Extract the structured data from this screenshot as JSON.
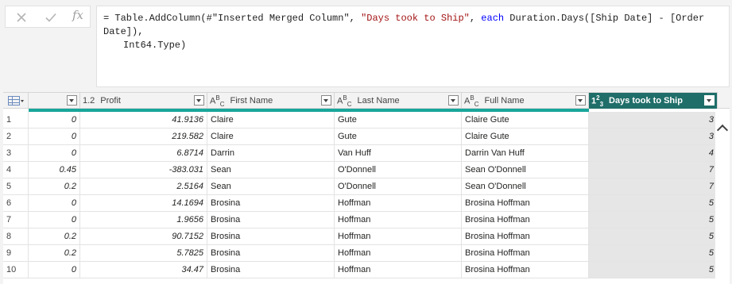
{
  "formula": {
    "prefix": "= Table.AddColumn(#\"Inserted Merged Column\", ",
    "col_name": "\"Days took to Ship\"",
    "mid": ", ",
    "each_kw": "each",
    "expr": " Duration.Days([Ship Date] - [Order Date]),",
    "line2": "Int64.Type)"
  },
  "columns": [
    {
      "type_label": "",
      "name": ""
    },
    {
      "type_label": "1.2",
      "name": "Profit"
    },
    {
      "type_label": "ABC",
      "name": "First Name"
    },
    {
      "type_label": "ABC",
      "name": "Last Name"
    },
    {
      "type_label": "ABC",
      "name": "Full Name"
    },
    {
      "type_label": "123",
      "name": "Days took to Ship"
    }
  ],
  "rows": [
    {
      "idx": "1",
      "c0": "0",
      "profit": "41.9136",
      "first": "Claire",
      "last": "Gute",
      "full": "Claire Gute",
      "days": "3"
    },
    {
      "idx": "2",
      "c0": "0",
      "profit": "219.582",
      "first": "Claire",
      "last": "Gute",
      "full": "Claire Gute",
      "days": "3"
    },
    {
      "idx": "3",
      "c0": "0",
      "profit": "6.8714",
      "first": "Darrin",
      "last": "Van Huff",
      "full": "Darrin Van Huff",
      "days": "4"
    },
    {
      "idx": "4",
      "c0": "0.45",
      "profit": "-383.031",
      "first": "Sean",
      "last": "O'Donnell",
      "full": "Sean O'Donnell",
      "days": "7"
    },
    {
      "idx": "5",
      "c0": "0.2",
      "profit": "2.5164",
      "first": "Sean",
      "last": "O'Donnell",
      "full": "Sean O'Donnell",
      "days": "7"
    },
    {
      "idx": "6",
      "c0": "0",
      "profit": "14.1694",
      "first": "Brosina",
      "last": "Hoffman",
      "full": "Brosina Hoffman",
      "days": "5"
    },
    {
      "idx": "7",
      "c0": "0",
      "profit": "1.9656",
      "first": "Brosina",
      "last": "Hoffman",
      "full": "Brosina Hoffman",
      "days": "5"
    },
    {
      "idx": "8",
      "c0": "0.2",
      "profit": "90.7152",
      "first": "Brosina",
      "last": "Hoffman",
      "full": "Brosina Hoffman",
      "days": "5"
    },
    {
      "idx": "9",
      "c0": "0.2",
      "profit": "5.7825",
      "first": "Brosina",
      "last": "Hoffman",
      "full": "Brosina Hoffman",
      "days": "5"
    },
    {
      "idx": "10",
      "c0": "0",
      "profit": "34.47",
      "first": "Brosina",
      "last": "Hoffman",
      "full": "Brosina Hoffman",
      "days": "5"
    }
  ],
  "colors": {
    "selected_header": "#1f6e69",
    "quality_bar": "#19a69a",
    "selected_column_bg": "#e6e6e6"
  }
}
